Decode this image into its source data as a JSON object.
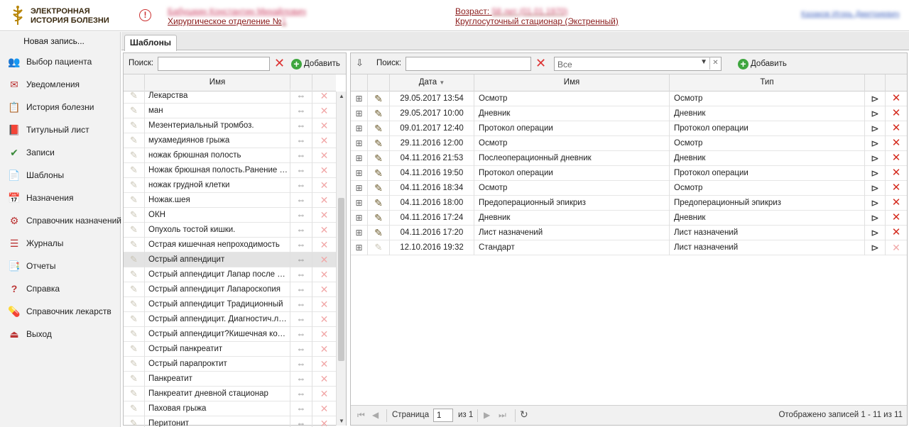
{
  "header": {
    "logo_line1": "ЭЛЕКТРОННАЯ",
    "logo_line2": "ИСТОРИЯ БОЛЕЗНИ",
    "patient_name": "Бабушкин Константин Михайлович",
    "department": "Хирургическое отделение №",
    "department_num": "1",
    "age_label": "Возраст:",
    "age_value": "58 лет (01.01.1970)",
    "stay_type": "Круглосуточный стационар (Экстренный)",
    "user_name": "Казаков Игорь Дмитриевич"
  },
  "sidebar": {
    "new_record": "Новая запись...",
    "items": [
      {
        "label": "Выбор пациента",
        "icon": "patients-icon"
      },
      {
        "label": "Уведомления",
        "icon": "mail-icon"
      },
      {
        "label": "История болезни",
        "icon": "history-icon"
      },
      {
        "label": "Титульный лист",
        "icon": "book-icon"
      },
      {
        "label": "Записи",
        "icon": "records-icon"
      },
      {
        "label": "Шаблоны",
        "icon": "templates-icon"
      },
      {
        "label": "Назначения",
        "icon": "calendar-icon"
      },
      {
        "label": "Справочник назначений",
        "icon": "network-icon"
      },
      {
        "label": "Журналы",
        "icon": "journal-icon"
      },
      {
        "label": "Отчеты",
        "icon": "report-icon"
      },
      {
        "label": "Справка",
        "icon": "help-icon"
      },
      {
        "label": "Справочник лекарств",
        "icon": "drugs-icon"
      },
      {
        "label": "Выход",
        "icon": "exit-icon"
      }
    ]
  },
  "tab": {
    "label": "Шаблоны"
  },
  "left": {
    "search_label": "Поиск:",
    "search_value": "",
    "add_label": "Добавить",
    "col_name": "Имя",
    "rows": [
      "Лекарства",
      "ман",
      "Мезентериальный тромбоз.",
      "мухамедиянов грыжа",
      "ножак брюшная полость",
      "Ножак брюшная полость.Ранение ж...",
      "ножак грудной клетки",
      "Ножак.шея",
      "ОКН",
      "Опухоль тостой кишки.",
      "Острая кишечная непроходимость",
      "Острый аппендицит",
      "Острый аппендицит Лапар после на...",
      "Острый аппендицит Лапароскопия",
      "Острый аппендицит Традиционный",
      "Острый аппендицит. Диагностич.ла...",
      "Острый аппендицит?Кишечная коли...",
      "Острый панкреатит",
      "Острый парапроктит",
      "Панкреатит",
      "Панкреатит дневной стационар",
      "Паховая грыжа",
      "Перитонит"
    ],
    "selected_index": 11
  },
  "right": {
    "search_label": "Поиск:",
    "search_value": "",
    "filter_value": "Все",
    "add_label": "Добавить",
    "col_date": "Дата",
    "col_name": "Имя",
    "col_type": "Тип",
    "rows": [
      {
        "date": "29.05.2017 13:54",
        "name": "Осмотр",
        "type": "Осмотр"
      },
      {
        "date": "29.05.2017 10:00",
        "name": "Дневник",
        "type": "Дневник"
      },
      {
        "date": "09.01.2017 12:40",
        "name": "Протокол операции",
        "type": "Протокол операции"
      },
      {
        "date": "29.11.2016 12:00",
        "name": "Осмотр",
        "type": "Осмотр"
      },
      {
        "date": "04.11.2016 21:53",
        "name": "Послеоперационный дневник",
        "type": "Дневник"
      },
      {
        "date": "04.11.2016 19:50",
        "name": "Протокол операции",
        "type": "Протокол операции"
      },
      {
        "date": "04.11.2016 18:34",
        "name": "Осмотр",
        "type": "Осмотр"
      },
      {
        "date": "04.11.2016 18:00",
        "name": "Предоперационный эпикриз",
        "type": "Предоперационный эпикриз"
      },
      {
        "date": "04.11.2016 17:24",
        "name": "Дневник",
        "type": "Дневник"
      },
      {
        "date": "04.11.2016 17:20",
        "name": "Лист назначений",
        "type": "Лист назначений"
      },
      {
        "date": "12.10.2016 19:32",
        "name": "Стандарт",
        "type": "Лист назначений"
      }
    ],
    "pager": {
      "page_label": "Страница",
      "page_value": "1",
      "of_label": "из 1",
      "summary": "Отображено записей 1 - 11 из 11"
    }
  }
}
